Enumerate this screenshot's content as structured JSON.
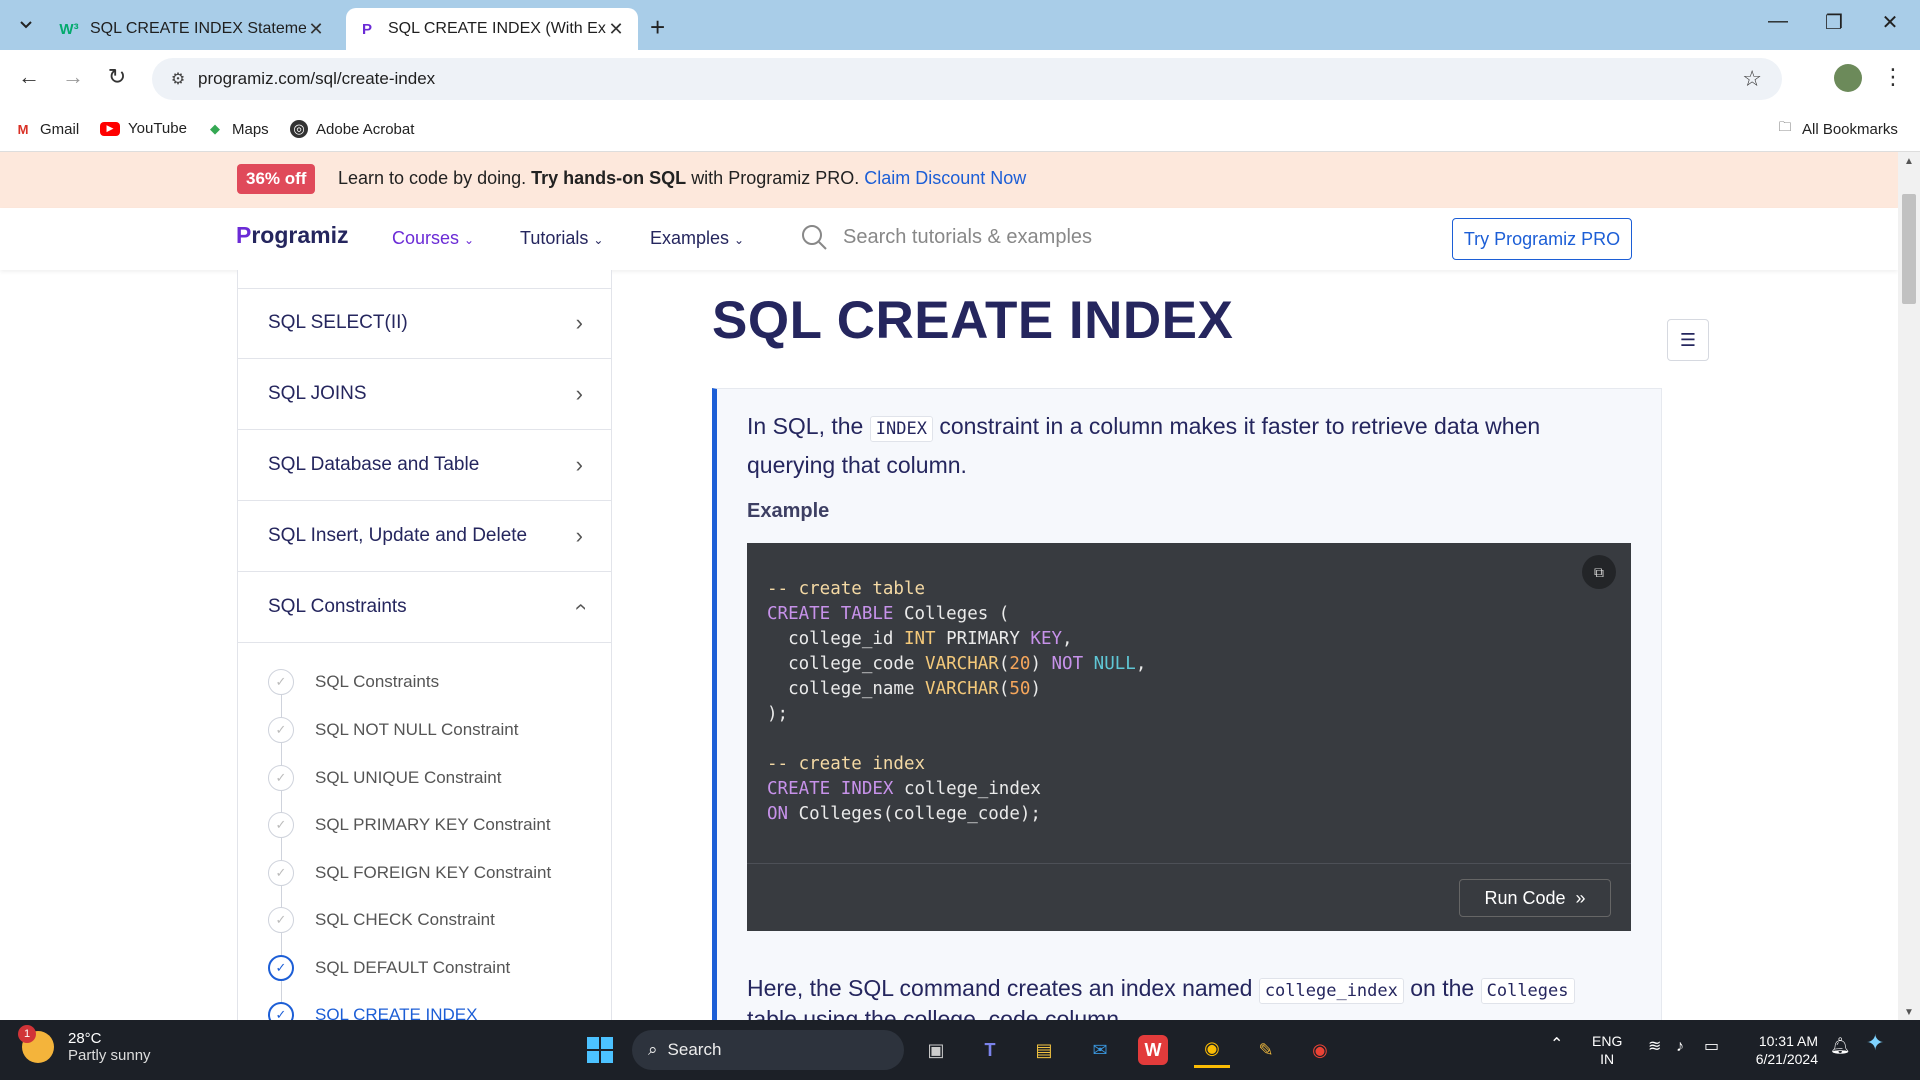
{
  "browser": {
    "tabs": [
      {
        "title": "SQL CREATE INDEX Statement",
        "favicon": "W³"
      },
      {
        "title": "SQL CREATE INDEX (With Exam",
        "favicon": "P"
      }
    ],
    "url": "programiz.com/sql/create-index",
    "bookmarks": [
      "Gmail",
      "YouTube",
      "Maps",
      "Adobe Acrobat"
    ],
    "all_bookmarks": "All Bookmarks"
  },
  "banner": {
    "badge": "36% off",
    "text_plain": "Learn to code by doing.",
    "text_bold": "Try hands-on SQL",
    "text_after": "with Programiz PRO.",
    "cta": "Claim Discount Now"
  },
  "site": {
    "logo_p": "P",
    "logo_rest": "rogramiz",
    "menu": [
      "Courses",
      "Tutorials",
      "Examples"
    ],
    "search_placeholder": "Search tutorials & examples",
    "pro_button": "Try Programiz PRO"
  },
  "sidebar": {
    "sections": [
      "SQL SELECT(II)",
      "SQL JOINS",
      "SQL Database and Table",
      "SQL Insert, Update and Delete",
      "SQL Constraints"
    ],
    "sub_items": [
      "SQL Constraints",
      "SQL NOT NULL Constraint",
      "SQL UNIQUE Constraint",
      "SQL PRIMARY KEY Constraint",
      "SQL FOREIGN KEY Constraint",
      "SQL CHECK Constraint",
      "SQL DEFAULT Constraint",
      "SQL CREATE INDEX"
    ]
  },
  "main": {
    "title": "SQL CREATE INDEX",
    "intro_before": "In SQL, the",
    "intro_code": "INDEX",
    "intro_after": "constraint in a column makes it faster to retrieve data when querying that column.",
    "example_label": "Example",
    "run_code": "Run Code",
    "para_before": "Here, the SQL command creates an index named",
    "para_code1": "college_index",
    "para_mid": "on the",
    "para_code2": "Colleges",
    "para2": "table using the college_code column."
  },
  "taskbar": {
    "temp": "28°C",
    "weather": "Partly sunny",
    "weather_badge": "1",
    "search": "Search",
    "lang1": "ENG",
    "lang2": "IN",
    "time": "10:31 AM",
    "date": "6/21/2024"
  },
  "colors": {
    "accent": "#1c5ed6",
    "brand": "#6b2bd6",
    "heading": "#25265e",
    "banner_bg": "#fde8dc",
    "badge": "#e04a5a"
  }
}
